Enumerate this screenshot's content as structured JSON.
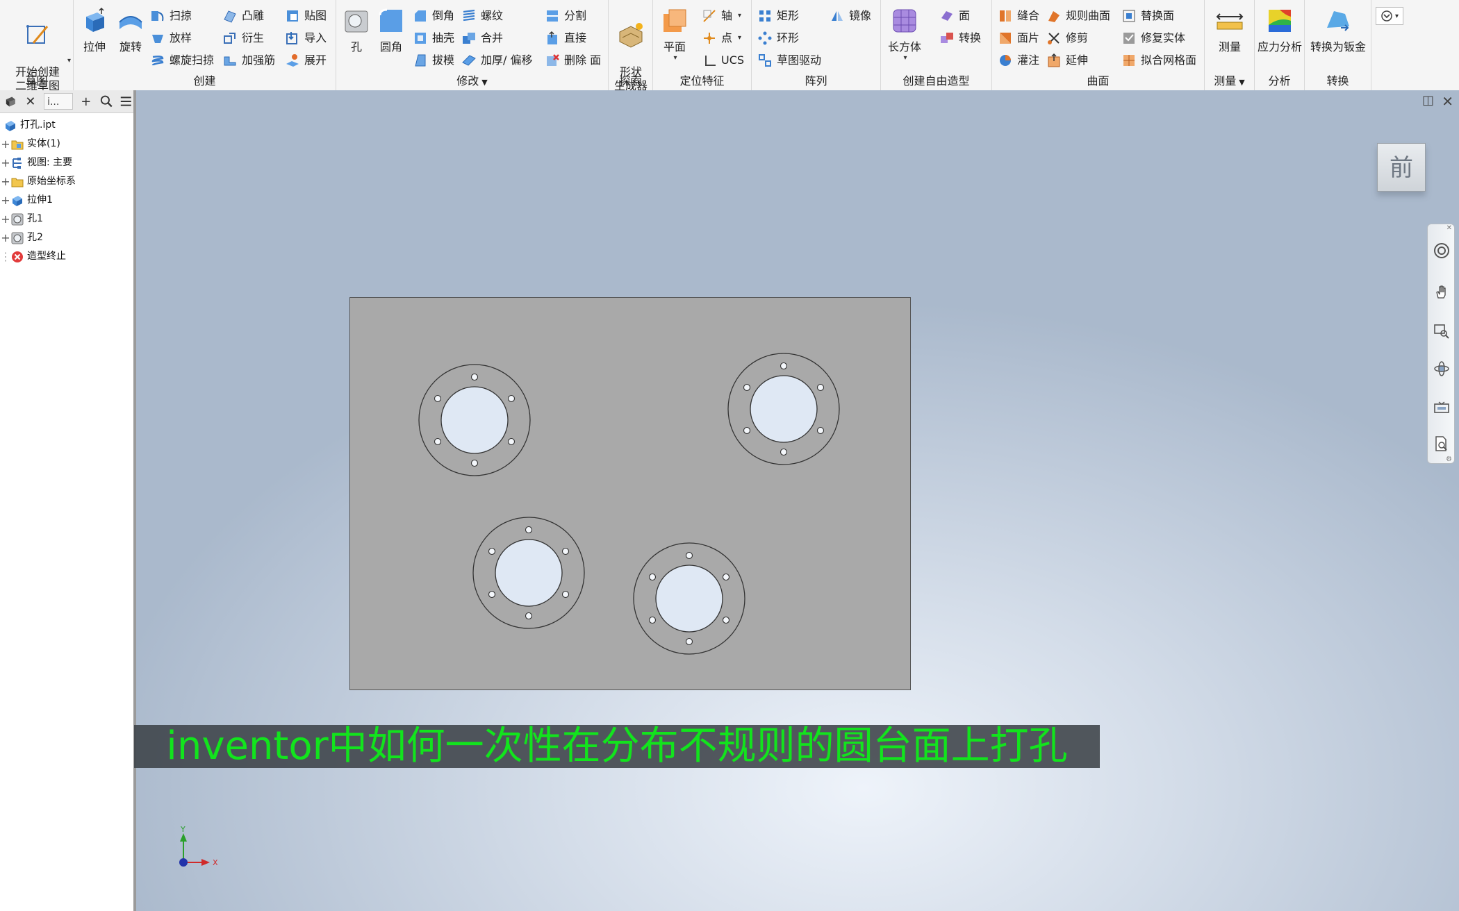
{
  "ribbon": {
    "sketch": {
      "label": "草图",
      "start_sketch": "开始创建\n二维草图"
    },
    "create": {
      "label": "创建",
      "extrude": "拉伸",
      "revolve": "旋转",
      "sweep": "扫掠",
      "loft": "放样",
      "coil": "螺旋扫掠",
      "emboss": "凸雕",
      "derive": "衍生",
      "rib": "加强筋",
      "decal": "贴图",
      "import": "导入",
      "unfold": "展开"
    },
    "modify": {
      "label": "修改",
      "hole": "孔",
      "fillet": "圆角",
      "chamfer": "倒角",
      "shell": "抽壳",
      "draft": "拔模",
      "thread": "螺纹",
      "combine": "合并",
      "thicken": "加厚/ 偏移",
      "split": "分割",
      "direct": "直接",
      "delete_face": "删除 面"
    },
    "explore": {
      "label": "探索",
      "shape_generator": "形状\n生成器"
    },
    "work_features": {
      "label": "定位特征",
      "plane": "平面",
      "axis": "轴",
      "point": "点",
      "ucs": "UCS"
    },
    "pattern": {
      "label": "阵列",
      "rectangular": "矩形",
      "circular": "环形",
      "sketch_driven": "草图驱动",
      "mirror": "镜像"
    },
    "freeform": {
      "label": "创建自由造型",
      "box": "长方体",
      "face": "面",
      "convert": "转换"
    },
    "surface": {
      "label": "曲面",
      "stitch": "缝合",
      "patch": "面片",
      "sculpt": "灌注",
      "ruled": "规则曲面",
      "trim": "修剪",
      "extend": "延伸",
      "replace_face": "替换面",
      "repair": "修复实体",
      "fit_mesh": "拟合网格面"
    },
    "measure": {
      "label": "测量",
      "measure": "测量"
    },
    "analysis": {
      "label": "分析",
      "stress": "应力分析"
    },
    "convert": {
      "label": "转换",
      "to_sheet_metal": "转换为钣金"
    }
  },
  "browser": {
    "tab_label": "i...",
    "tree": [
      {
        "label": "打孔.ipt",
        "icon": "part-icon"
      },
      {
        "label": "实体(1)",
        "icon": "solid-bodies-folder-icon"
      },
      {
        "label": "视图: 主要",
        "icon": "view-rep-icon"
      },
      {
        "label": "原始坐标系",
        "icon": "origin-folder-icon"
      },
      {
        "label": "拉伸1",
        "icon": "extrude-feature-icon"
      },
      {
        "label": "孔1",
        "icon": "hole-feature-icon"
      },
      {
        "label": "孔2",
        "icon": "hole-feature-icon"
      },
      {
        "label": "造型终止",
        "icon": "end-of-part-icon"
      }
    ]
  },
  "viewport": {
    "viewcube_face": "前",
    "subtitle": "inventor中如何一次性在分布不规则的圆台面上打孔",
    "axis_x": "X",
    "axis_y": "Y"
  }
}
